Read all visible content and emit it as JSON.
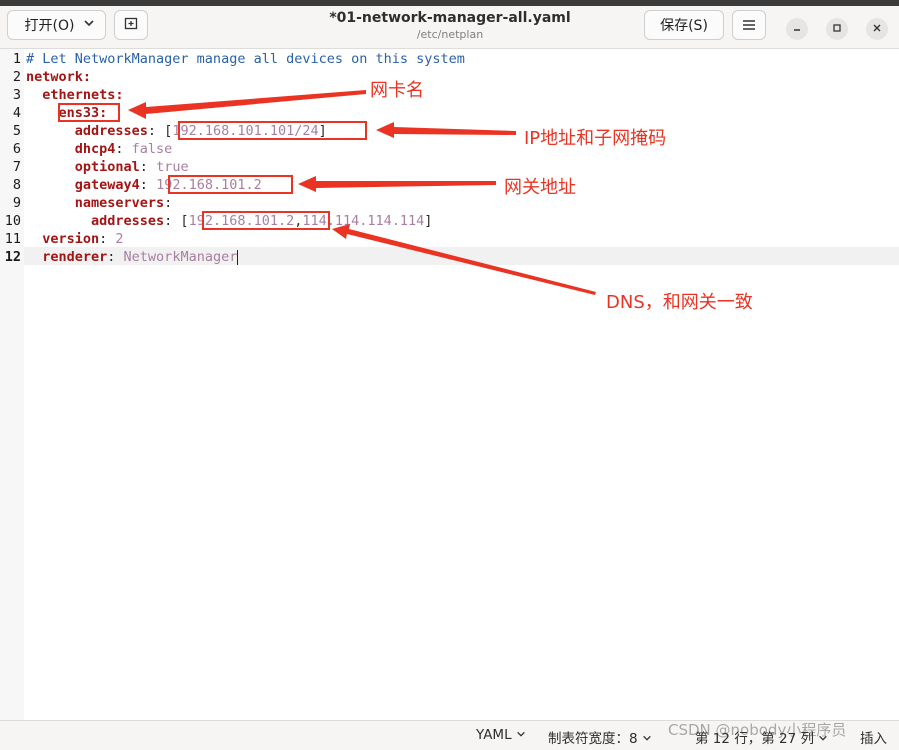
{
  "window": {
    "title": "*01-network-manager-all.yaml",
    "subtitle": "/etc/netplan"
  },
  "toolbar": {
    "open_label": "打开(O)",
    "save_label": "保存(S)",
    "menu_icon": "hamburger-icon",
    "newtab_icon": "new-tab-icon"
  },
  "code_lines": [
    {
      "n": "1",
      "parts": [
        {
          "t": "# Let NetworkManager manage all devices on this system",
          "c": "comment"
        }
      ]
    },
    {
      "n": "2",
      "parts": [
        {
          "t": "network",
          "c": "key"
        },
        {
          "t": ":",
          "c": "key"
        }
      ]
    },
    {
      "n": "3",
      "parts": [
        {
          "t": "  ethernets",
          "c": "key"
        },
        {
          "t": ":",
          "c": "key"
        }
      ]
    },
    {
      "n": "4",
      "parts": [
        {
          "t": "    ens33",
          "c": "key"
        },
        {
          "t": ":",
          "c": "key"
        }
      ]
    },
    {
      "n": "5",
      "parts": [
        {
          "t": "      addresses",
          "c": "key"
        },
        {
          "t": ": [",
          "c": "punct"
        },
        {
          "t": "192.168.101.101/24",
          "c": "val"
        },
        {
          "t": "]",
          "c": "punct"
        }
      ]
    },
    {
      "n": "6",
      "parts": [
        {
          "t": "      dhcp4",
          "c": "key"
        },
        {
          "t": ": ",
          "c": "punct"
        },
        {
          "t": "false",
          "c": "val"
        }
      ]
    },
    {
      "n": "7",
      "parts": [
        {
          "t": "      optional",
          "c": "key"
        },
        {
          "t": ": ",
          "c": "punct"
        },
        {
          "t": "true",
          "c": "val"
        }
      ]
    },
    {
      "n": "8",
      "parts": [
        {
          "t": "      gateway4",
          "c": "key"
        },
        {
          "t": ": ",
          "c": "punct"
        },
        {
          "t": "192.168.101.2",
          "c": "val"
        }
      ]
    },
    {
      "n": "9",
      "parts": [
        {
          "t": "      nameservers",
          "c": "key"
        },
        {
          "t": ":",
          "c": "punct"
        }
      ]
    },
    {
      "n": "10",
      "parts": [
        {
          "t": "        addresses",
          "c": "key"
        },
        {
          "t": ": [",
          "c": "punct"
        },
        {
          "t": "192.168.101.2",
          "c": "val"
        },
        {
          "t": ",",
          "c": "punct"
        },
        {
          "t": "114.114.114.114",
          "c": "val"
        },
        {
          "t": "]",
          "c": "punct"
        }
      ]
    },
    {
      "n": "11",
      "parts": [
        {
          "t": "  version",
          "c": "key"
        },
        {
          "t": ": ",
          "c": "punct"
        },
        {
          "t": "2",
          "c": "val"
        }
      ]
    },
    {
      "n": "12",
      "parts": [
        {
          "t": "  renderer",
          "c": "key"
        },
        {
          "t": ": ",
          "c": "punct"
        },
        {
          "t": "NetworkManager",
          "c": "val"
        }
      ]
    }
  ],
  "current_line": "12",
  "annotations": {
    "nic_name": "网卡名",
    "ip_mask": "IP地址和子网掩码",
    "gateway": "网关地址",
    "dns": "DNS，和网关一致"
  },
  "status": {
    "language": "YAML",
    "tab_width": "制表符宽度：8",
    "position": "第 12 行，第 27 列",
    "mode": "插入",
    "watermark": "CSDN @nobody小程序员"
  },
  "colors": {
    "annotation": "#ea3323",
    "comment": "#2b61a8",
    "key": "#a31515",
    "value": "#a97ea3"
  }
}
